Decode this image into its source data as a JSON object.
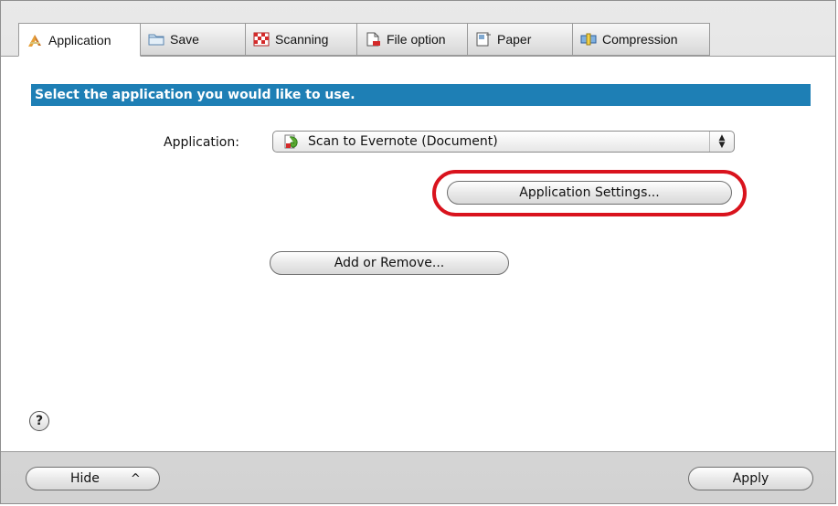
{
  "tabs": [
    {
      "label": "Application",
      "icon": "application-icon",
      "active": true
    },
    {
      "label": "Save",
      "icon": "folder-icon",
      "active": false
    },
    {
      "label": "Scanning",
      "icon": "scanning-icon",
      "active": false
    },
    {
      "label": "File option",
      "icon": "file-option-icon",
      "active": false
    },
    {
      "label": "Paper",
      "icon": "paper-icon",
      "active": false
    },
    {
      "label": "Compression",
      "icon": "compression-icon",
      "active": false
    }
  ],
  "panel": {
    "banner": "Select the application you would like to use.",
    "application_label": "Application:",
    "application_value": "Scan to Evernote (Document)",
    "settings_button": "Application Settings...",
    "add_remove_button": "Add or Remove..."
  },
  "help_label": "?",
  "footer": {
    "hide_button": "Hide",
    "hide_chevron": "^",
    "apply_button": "Apply"
  },
  "colors": {
    "banner_bg": "#1e7fb5",
    "highlight": "#d9131d"
  }
}
